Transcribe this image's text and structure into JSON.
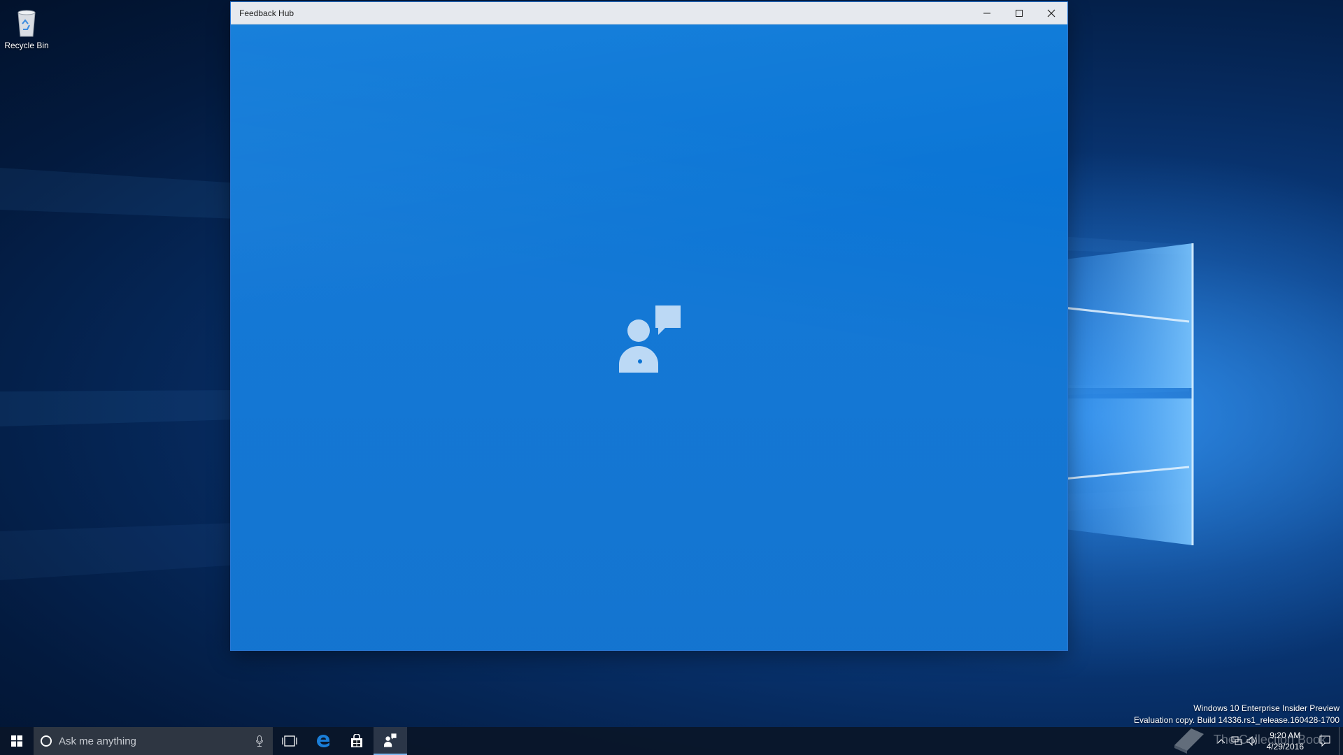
{
  "desktop": {
    "icons": [
      {
        "label": "Recycle Bin",
        "icon": "recycle-bin-icon"
      }
    ],
    "watermark": {
      "line1": "Windows 10 Enterprise Insider Preview",
      "line2": "Evaluation copy. Build 14336.rs1_release.160428-1700"
    },
    "overlay_text": "The Collection Book"
  },
  "window": {
    "title": "Feedback Hub",
    "controls": {
      "minimize": "minimize-icon",
      "maximize": "maximize-icon",
      "close": "close-icon"
    },
    "splash_icon": "feedback-hub-icon",
    "accent": "#0a74d6"
  },
  "taskbar": {
    "start_icon": "windows-logo-icon",
    "search": {
      "placeholder": "Ask me anything",
      "icon": "cortana-icon",
      "mic_icon": "microphone-icon"
    },
    "pinned": [
      {
        "name": "task-view",
        "icon": "task-view-icon"
      },
      {
        "name": "edge",
        "icon": "edge-icon"
      },
      {
        "name": "store",
        "icon": "store-icon"
      },
      {
        "name": "feedback-hub",
        "icon": "feedback-hub-icon",
        "active": true
      }
    ],
    "tray": {
      "icons": [
        "chevron-up-icon",
        "network-icon",
        "volume-icon"
      ],
      "time": "9:20 AM",
      "date": "4/29/2016",
      "notification_icon": "action-center-icon"
    }
  }
}
